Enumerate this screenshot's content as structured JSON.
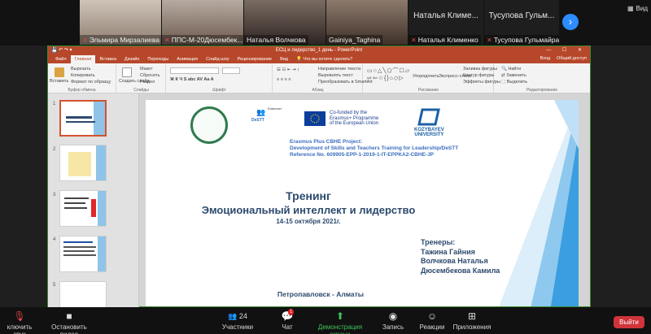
{
  "participants": [
    {
      "name": "Эльмира Мирзалиева",
      "muted": true
    },
    {
      "name": "ППС-М-20Дюсембек...",
      "muted": true
    },
    {
      "name": "Наталья Волчкова",
      "muted": false
    },
    {
      "name": "Gainiya_Taghina",
      "muted": false
    },
    {
      "name": "Наталья Клименко",
      "muted": true,
      "top_name": "Наталья  Климе..."
    },
    {
      "name": "Тусупова Гульмайра ...",
      "muted": true,
      "top_name": "Тусупова  Гульм..."
    }
  ],
  "view_label": "Вид",
  "ppt": {
    "window_title": "ЕСЦ и лидерство_1 день - PowerPoint",
    "tabs": [
      "Файл",
      "Главная",
      "Вставка",
      "Дизайн",
      "Переходы",
      "Анимация",
      "Слайд-шоу",
      "Рецензирование",
      "Вид"
    ],
    "tell_me": "Что вы хотите сделать?",
    "login": "Вход",
    "share": "Общий доступ",
    "ribbon_groups": [
      "Буфер обмена",
      "Слайды",
      "Шрифт",
      "Абзац",
      "Рисование",
      "Редактирование"
    ],
    "ribbon_items": {
      "paste": "Вставить",
      "cut": "Вырезать",
      "copy": "Копировать",
      "format": "Формат по образцу",
      "new_slide": "Создать слайд",
      "layout": "Макет",
      "reset": "Сбросить",
      "section": "Раздел",
      "text_dir": "Направление текста",
      "align_text": "Выровнять текст",
      "smartart": "Преобразовать в SmartArt",
      "arrange": "Упорядочить",
      "quick_styles": "Экспресс-стили",
      "fill": "Заливка фигуры",
      "outline": "Контур фигуры",
      "effects": "Эффекты фигуры",
      "find": "Найти",
      "replace": "Заменить",
      "select": "Выделить"
    },
    "thumb_numbers": [
      "1",
      "2",
      "3",
      "4",
      "5"
    ],
    "slide": {
      "erasmus_small": "Erasmus+",
      "destt_logo": "DeSTT",
      "eu_text": [
        "Co-funded by the",
        "Erasmus+ Programme",
        "of the European Union"
      ],
      "kozy": [
        "KOZYBAYEV",
        "UNIVERSITY"
      ],
      "project": [
        "Erasmus Plus CBHE Project:",
        "Development of Skills and Teachers Training for Leadership/DeSTT",
        "Reference No. 609905-EPP-1-2019-1-IT-EPPKA2-CBHE-JP"
      ],
      "title1": "Тренинг",
      "title2": "Эмоциональный интеллект и лидерство",
      "dates": "14-15 октября 2021г.",
      "trainers_label": "Тренеры:",
      "trainers": [
        "Тажина Гайния",
        "Волчкова Наталья",
        "Дюсембекова Камила"
      ],
      "city": "Петропавловск - Алматы"
    }
  },
  "toolbar": {
    "mute": "ключить звук",
    "video": "Остановить видео",
    "participants": "Участники",
    "participants_count": "24",
    "chat": "Чат",
    "chat_badge": "1",
    "share": "Демонстрация экрана",
    "record": "Запись",
    "reactions": "Реакции",
    "apps": "Приложения",
    "end": "Выйти"
  }
}
